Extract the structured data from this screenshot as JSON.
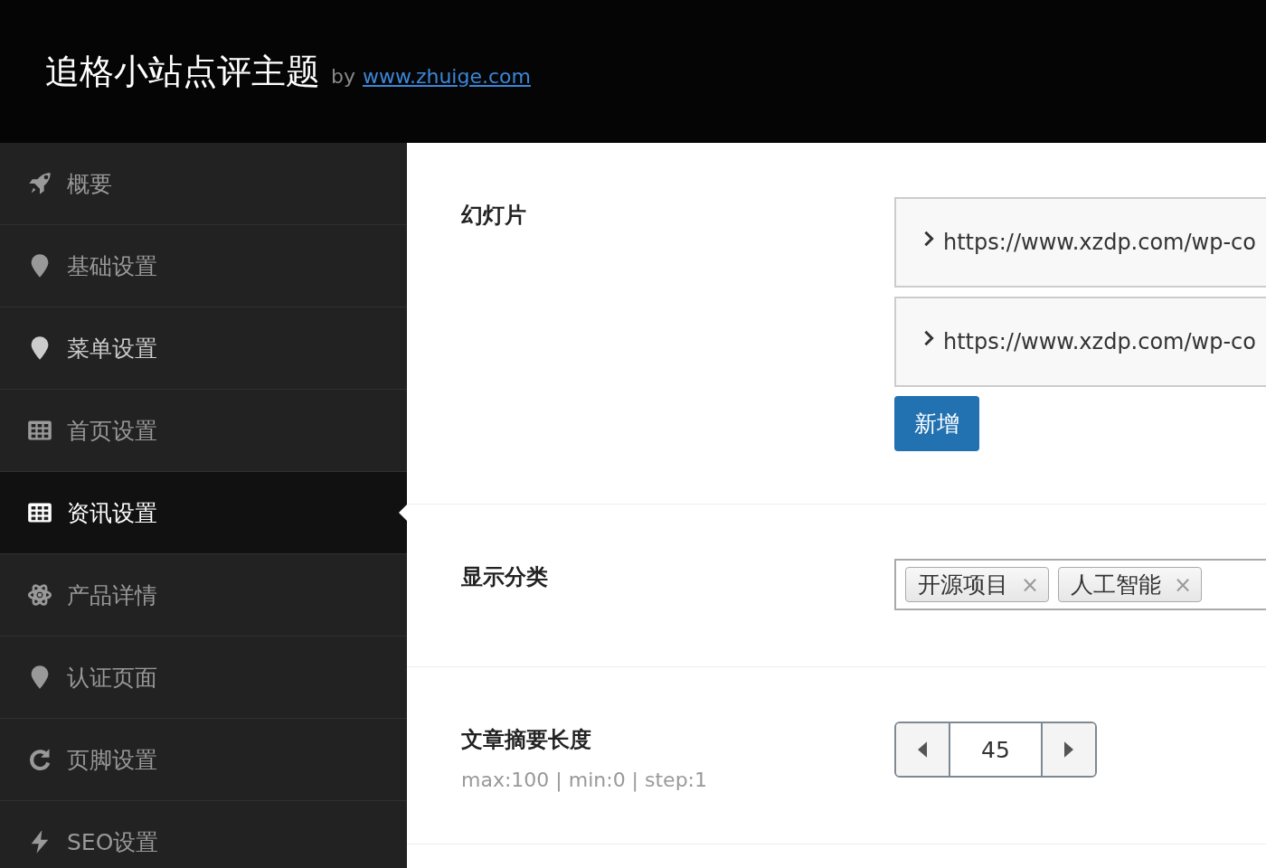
{
  "header": {
    "title": "追格小站点评主题",
    "by": "by",
    "link": "www.zhuige.com"
  },
  "sidebar": {
    "items": [
      {
        "label": "概要",
        "selected": false,
        "hovered": false
      },
      {
        "label": "基础设置",
        "selected": false,
        "hovered": false
      },
      {
        "label": "菜单设置",
        "selected": false,
        "hovered": true
      },
      {
        "label": "首页设置",
        "selected": false,
        "hovered": false
      },
      {
        "label": "资讯设置",
        "selected": true,
        "hovered": false
      },
      {
        "label": "产品详情",
        "selected": false,
        "hovered": false
      },
      {
        "label": "认证页面",
        "selected": false,
        "hovered": false
      },
      {
        "label": "页脚设置",
        "selected": false,
        "hovered": false
      },
      {
        "label": "SEO设置",
        "selected": false,
        "hovered": false
      }
    ]
  },
  "fields": [
    {
      "kind": "slides",
      "label": "幻灯片",
      "items": [
        "https://www.xzdp.com/wp-co",
        "https://www.xzdp.com/wp-co"
      ],
      "add_button": "新增"
    },
    {
      "kind": "tags",
      "label": "显示分类",
      "tags": [
        "开源项目",
        "人工智能"
      ],
      "remove": "×"
    },
    {
      "kind": "spinner",
      "label": "文章摘要长度",
      "hint": "max:100 | min:0 | step:1",
      "value": "45"
    }
  ]
}
